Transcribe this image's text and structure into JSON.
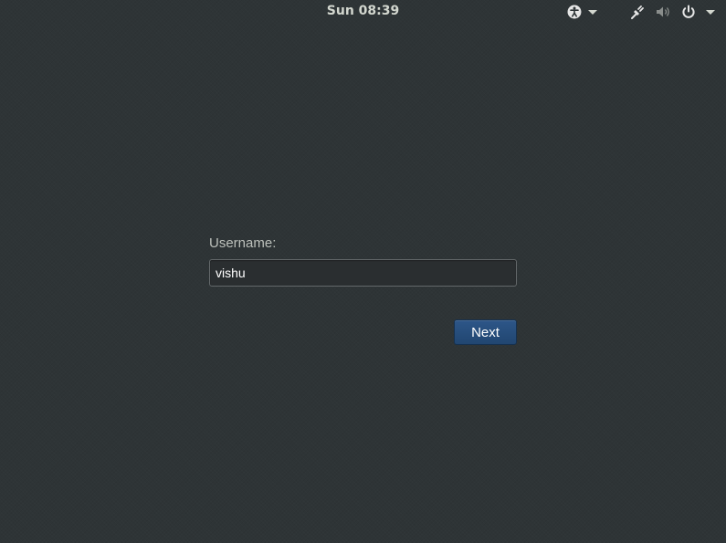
{
  "top_bar": {
    "clock": "Sun 08:39",
    "accessibility_menu": {
      "icon": "accessibility-icon"
    },
    "system_menu": {
      "icons": [
        "network-icon",
        "volume-muted-icon",
        "power-icon"
      ]
    }
  },
  "login": {
    "username_label": "Username:",
    "username_value": "vishu",
    "next_label": "Next"
  },
  "colors": {
    "background": "#2e3436",
    "button": "#274e7a",
    "text": "#eeeeec"
  }
}
